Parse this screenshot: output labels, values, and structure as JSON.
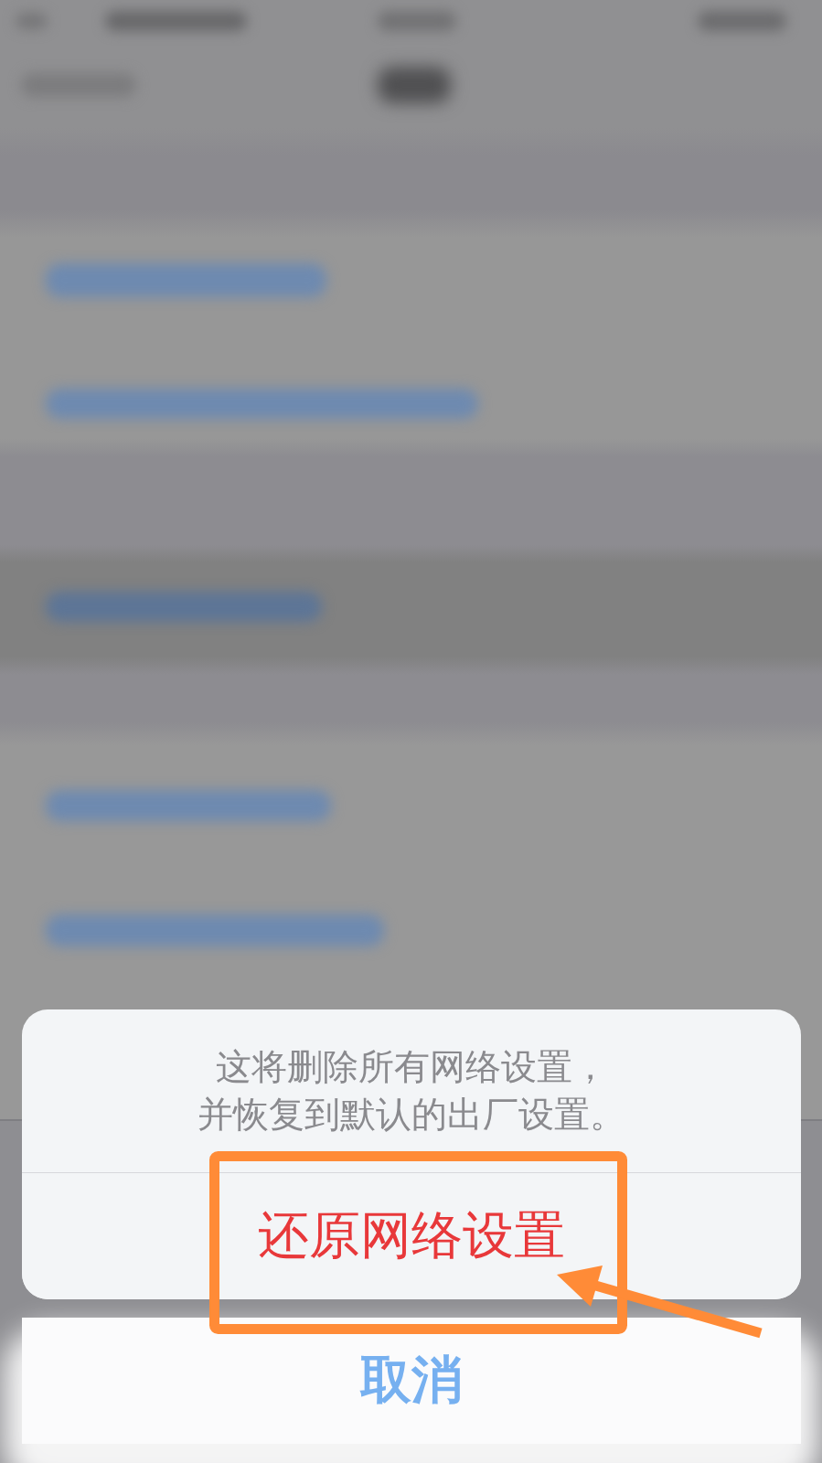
{
  "action_sheet": {
    "message_lines": [
      "这将删除所有网络设置，",
      "并恢复到默认的出厂设置。"
    ],
    "actions": [
      {
        "label": "还原网络设置",
        "kind": "destructive"
      }
    ],
    "cancel": {
      "label": "取消"
    }
  }
}
